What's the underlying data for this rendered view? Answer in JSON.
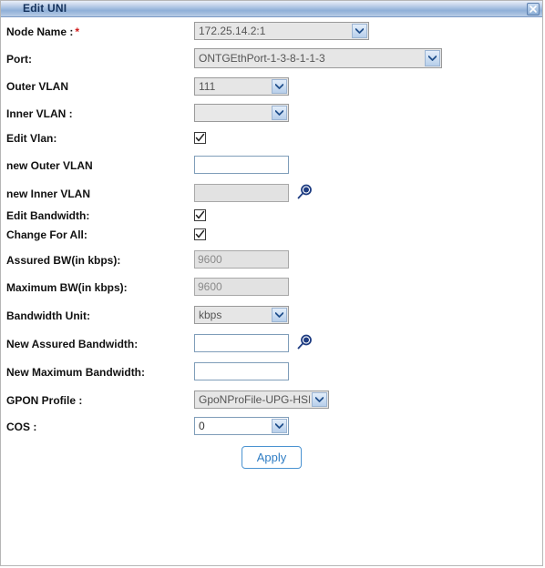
{
  "window": {
    "title": "Edit UNI",
    "close_icon": "close-icon"
  },
  "form": {
    "rows": [
      {
        "label": "Node Name :",
        "required": true,
        "control": "select",
        "value": "172.25.14.2:1"
      },
      {
        "label": "Port:",
        "required": false,
        "control": "select",
        "value": "ONTGEthPort-1-3-8-1-1-3"
      },
      {
        "label": "Outer VLAN",
        "required": false,
        "control": "select",
        "value": "111"
      },
      {
        "label": "Inner VLAN :",
        "required": false,
        "control": "select",
        "value": ""
      },
      {
        "label": "Edit Vlan:",
        "required": false,
        "control": "checkbox",
        "value": "checked"
      },
      {
        "label": "new Outer VLAN",
        "required": false,
        "control": "text",
        "value": ""
      },
      {
        "label": "new Inner VLAN",
        "required": false,
        "control": "text-disabled-search",
        "value": ""
      },
      {
        "label": "Edit Bandwidth:",
        "required": false,
        "control": "checkbox",
        "value": "checked"
      },
      {
        "label": "Change For All:",
        "required": false,
        "control": "checkbox",
        "value": "checked"
      },
      {
        "label": "Assured BW(in kbps):",
        "required": false,
        "control": "text-disabled",
        "value": "9600"
      },
      {
        "label": "Maximum BW(in kbps):",
        "required": false,
        "control": "text-disabled",
        "value": "9600"
      },
      {
        "label": "Bandwidth Unit:",
        "required": false,
        "control": "select",
        "value": "kbps"
      },
      {
        "label": "New Assured Bandwidth:",
        "required": false,
        "control": "text-search",
        "value": ""
      },
      {
        "label": "New Maximum Bandwidth:",
        "required": false,
        "control": "text",
        "value": ""
      },
      {
        "label": "GPON Profile :",
        "required": false,
        "control": "select",
        "value": "GpoNProFile-UPG-HSI"
      },
      {
        "label": "COS :",
        "required": false,
        "control": "select",
        "value": "0"
      }
    ],
    "search_icon": "search-icon",
    "apply_label": "Apply"
  },
  "colors": {
    "title_text": "#13315c",
    "required_asterisk": "#d01818",
    "apply_text": "#2f7dc4",
    "icon_blue": "#1f3d82"
  }
}
